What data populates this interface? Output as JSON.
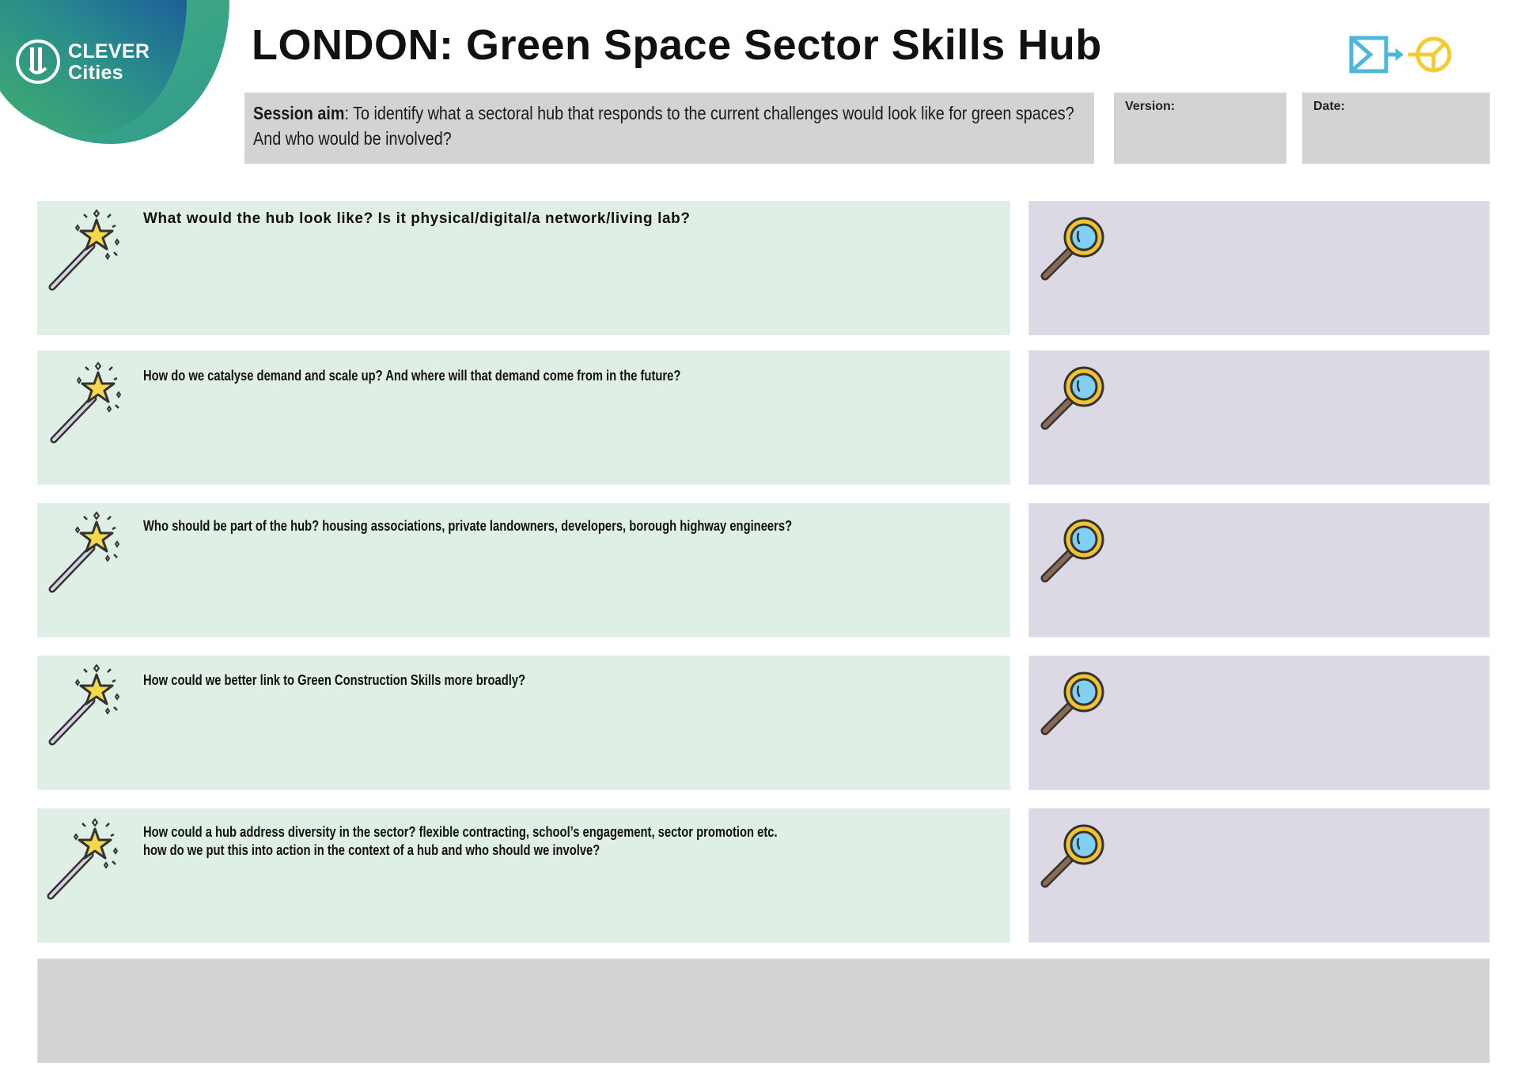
{
  "logo": {
    "line1": "CLEVER",
    "line2": "Cities"
  },
  "page_title": "LONDON: Green Space Sector Skills Hub",
  "session": {
    "aim_label": "Session aim",
    "aim_text": ": To identify what a sectoral hub that responds to the current challenges would look like for green spaces? And who would be involved?",
    "version_label": "Version:",
    "date_label": "Date:"
  },
  "questions": [
    {
      "text": "What would the hub look like? Is it physical/digital/a network/living lab?"
    },
    {
      "text": "How do we catalyse demand and scale up? And where will that demand come from in the future?"
    },
    {
      "text": "Who should be part of the hub? housing associations, private landowners, developers, borough highway engineers?"
    },
    {
      "text": "How could we better link to Green Construction Skills more broadly?"
    },
    {
      "text": "How could a hub address diversity in the sector? flexible contracting, school’s engagement, sector promotion etc.",
      "text2": "how do we put this into action in the context of a hub and who should we involve?"
    }
  ],
  "icons": {
    "question": "magic-wand-icon",
    "notes": "magnifying-glass-icon",
    "process": "process-flow-icon"
  },
  "colors": {
    "question_card": "#e0efe6",
    "notes_card": "#dcd9e4",
    "grey_box": "#d3d3d3",
    "logo_green": "#3aa57a",
    "logo_blue": "#1f5d99",
    "icon_cyan": "#4db7da",
    "icon_yellow": "#f2cc35"
  }
}
